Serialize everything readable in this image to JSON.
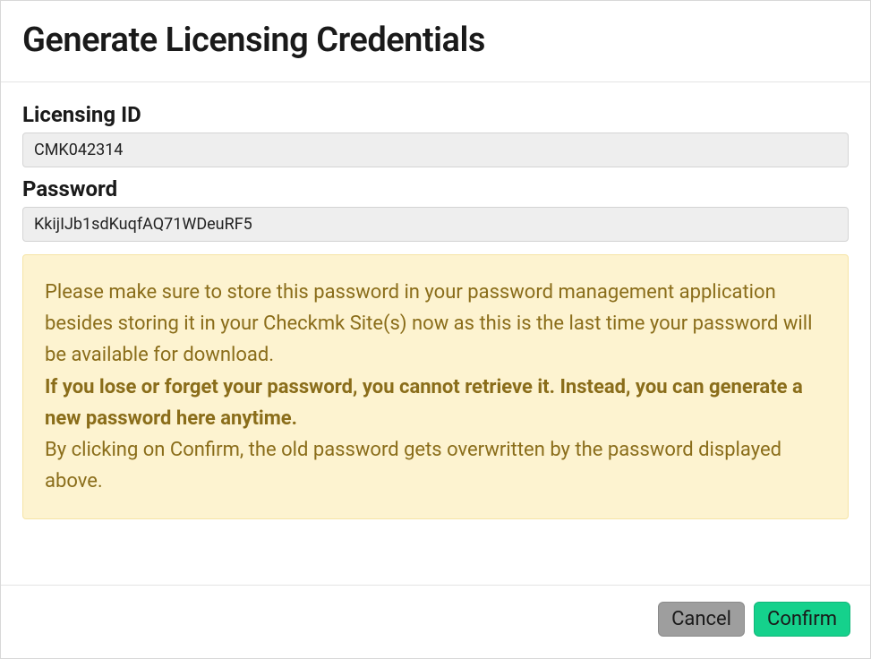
{
  "dialog": {
    "title": "Generate Licensing Credentials"
  },
  "fields": {
    "licensing_id": {
      "label": "Licensing ID",
      "value": "CMK042314"
    },
    "password": {
      "label": "Password",
      "value": "KkijIJb1sdKuqfAQ71WDeuRF5"
    }
  },
  "warning": {
    "line1": "Please make sure to store this password in your password management application besides storing it in your Checkmk Site(s) now as this is the last time your password will be available for download.",
    "line2": "If you lose or forget your password, you cannot retrieve it. Instead, you can generate a new password here anytime.",
    "line3": "By clicking on Confirm, the old password gets overwritten by the password displayed above."
  },
  "buttons": {
    "cancel": "Cancel",
    "confirm": "Confirm"
  }
}
